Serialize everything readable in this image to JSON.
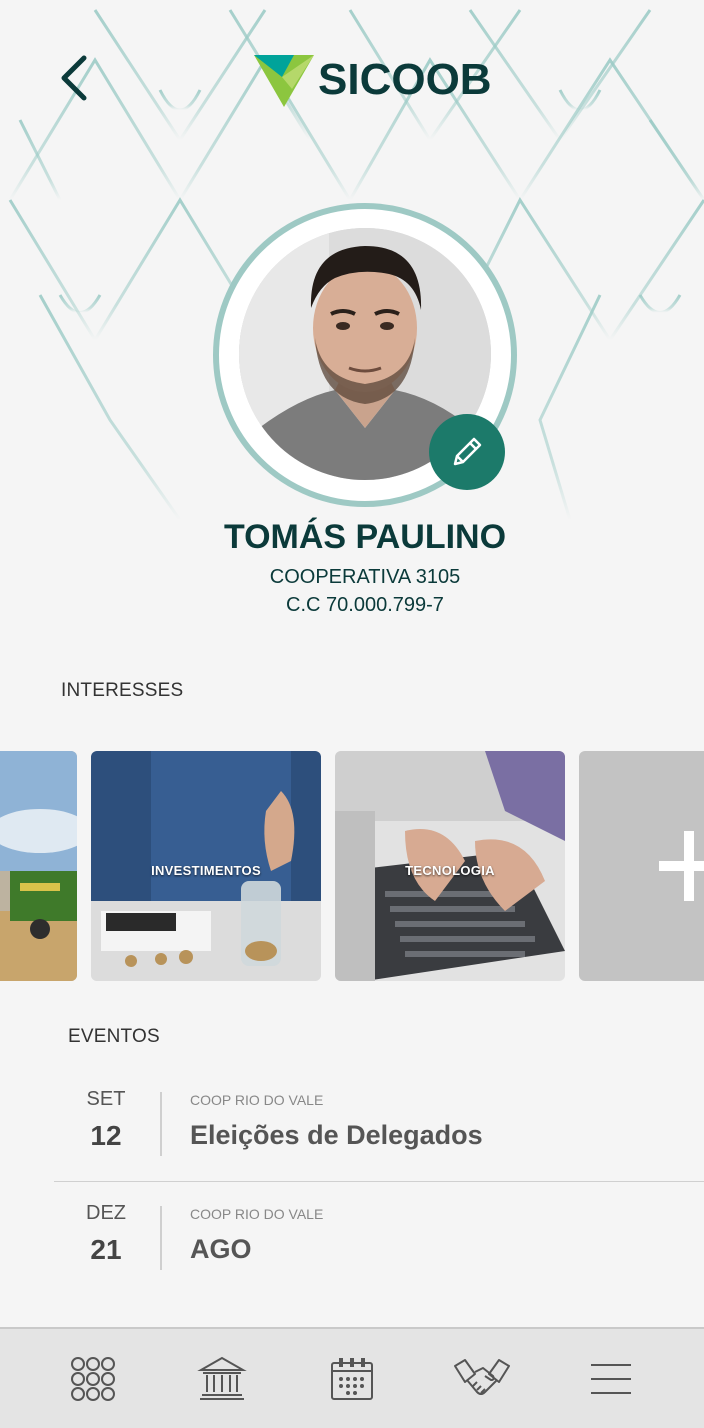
{
  "header": {
    "brand": "SICOOB"
  },
  "profile": {
    "name": "TOMÁS PAULINO",
    "cooperative": "COOPERATIVA 3105",
    "account": "C.C 70.000.799-7"
  },
  "interests": {
    "title": "INTERESSES",
    "items": [
      {
        "label": ""
      },
      {
        "label": "INVESTIMENTOS"
      },
      {
        "label": "TECNOLOGIA"
      }
    ],
    "add_glyph": "+"
  },
  "events": {
    "title": "EVENTOS",
    "items": [
      {
        "month": "SET",
        "day": "12",
        "org": "COOP RIO DO VALE",
        "title": "Eleições de Delegados"
      },
      {
        "month": "DEZ",
        "day": "21",
        "org": "COOP RIO DO VALE",
        "title": "AGO"
      }
    ]
  },
  "colors": {
    "primary": "#0b3a3a",
    "accent": "#1c7a6a",
    "logo_green": "#8cc63f",
    "logo_teal": "#00a39a"
  },
  "tabbar": {
    "items": [
      {
        "icon": "grid-icon"
      },
      {
        "icon": "bank-icon"
      },
      {
        "icon": "calendar-icon"
      },
      {
        "icon": "handshake-icon"
      },
      {
        "icon": "menu-icon"
      }
    ]
  }
}
